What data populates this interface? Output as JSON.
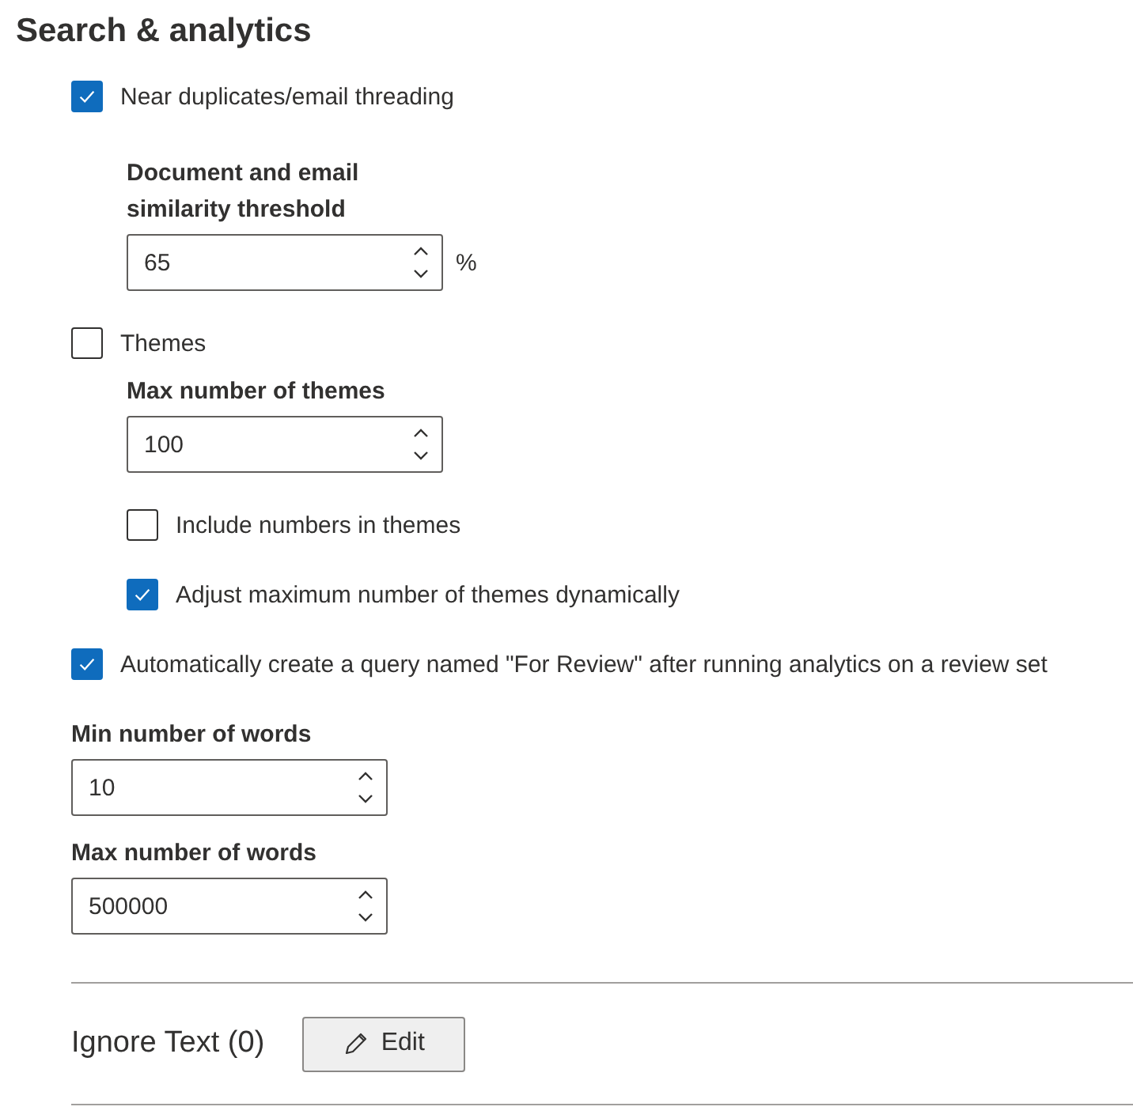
{
  "title": "Search & analytics",
  "options": [
    {
      "kind": "checkbox",
      "label": "Near duplicates/email threading",
      "checked": true,
      "children": [
        {
          "kind": "number",
          "label": "Document and email similarity threshold",
          "value": "65",
          "unit": "%"
        }
      ]
    },
    {
      "kind": "checkbox",
      "label": "Themes",
      "checked": false,
      "children": [
        {
          "kind": "number",
          "label": "Max number of themes",
          "value": "100"
        },
        {
          "kind": "checkbox",
          "label": "Include numbers in themes",
          "checked": false
        },
        {
          "kind": "checkbox",
          "label": "Adjust maximum number of themes dynamically",
          "checked": true
        }
      ]
    },
    {
      "kind": "checkbox",
      "label": "Automatically create a query named \"For Review\" after running analytics on a review set",
      "checked": true
    },
    {
      "kind": "number",
      "label": "Min number of words",
      "value": "10"
    },
    {
      "kind": "number",
      "label": "Max number of words",
      "value": "500000"
    }
  ],
  "ignore_text": {
    "label": "Ignore Text (0)",
    "button": "Edit"
  }
}
